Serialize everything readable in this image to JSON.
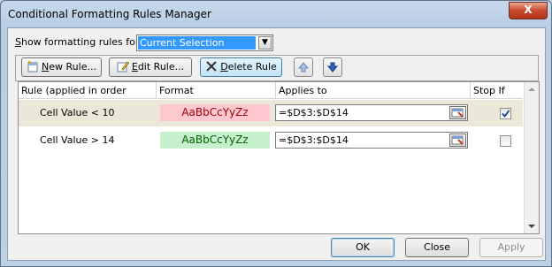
{
  "window": {
    "title": "Conditional Formatting Rules Manager",
    "close_label": "X"
  },
  "scope": {
    "label_prefix": "S",
    "label_rest": "how formatting rules for:",
    "selected": "Current Selection"
  },
  "toolbar": {
    "new_rule_accel": "N",
    "new_rule_rest": "ew Rule...",
    "edit_rule_accel": "E",
    "edit_rule_rest": "dit Rule...",
    "delete_rule_accel": "D",
    "delete_rule_rest": "elete Rule"
  },
  "grid": {
    "columns": [
      "Rule (applied in order shown)",
      "Format",
      "Applies to",
      "Stop If True"
    ],
    "rows": [
      {
        "rule": "Cell Value < 10",
        "preview": "AaBbCcYyZz",
        "preview_bg": "#ffc7ce",
        "preview_fg": "#9c0006",
        "applies_to": "=$D$3:$D$14",
        "stop_if_true": true,
        "selected": true
      },
      {
        "rule": "Cell Value > 14",
        "preview": "AaBbCcYyZz",
        "preview_bg": "#c6efce",
        "preview_fg": "#006100",
        "applies_to": "=$D$3:$D$14",
        "stop_if_true": false,
        "selected": false
      }
    ]
  },
  "footer": {
    "ok": "OK",
    "close": "Close",
    "apply": "Apply"
  }
}
